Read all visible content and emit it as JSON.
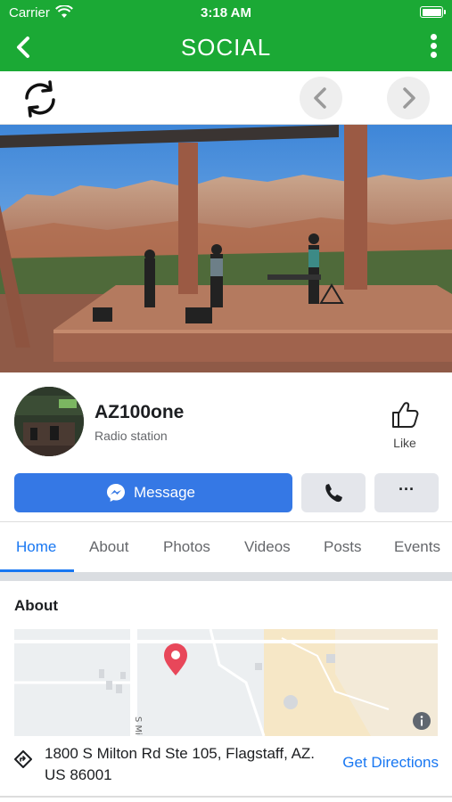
{
  "status_bar": {
    "carrier": "Carrier",
    "time": "3:18 AM"
  },
  "nav": {
    "title": "SOCIAL"
  },
  "profile": {
    "name": "AZ100one",
    "category": "Radio station",
    "like_label": "Like"
  },
  "actions": {
    "message_label": "Message",
    "options_label": "···"
  },
  "tabs": [
    {
      "label": "Home",
      "active": true
    },
    {
      "label": "About",
      "active": false
    },
    {
      "label": "Photos",
      "active": false
    },
    {
      "label": "Videos",
      "active": false
    },
    {
      "label": "Posts",
      "active": false
    },
    {
      "label": "Events",
      "active": false
    }
  ],
  "about": {
    "title": "About",
    "address": "1800 S Milton Rd Ste 105, Flagstaff, AZ. US 86001",
    "directions_label": "Get Directions",
    "map_street_label": "S Mi"
  },
  "colors": {
    "nav_green": "#1ba935",
    "accent_blue": "#1877f2",
    "message_blue": "#3578e5",
    "map_pin": "#e8475a"
  }
}
